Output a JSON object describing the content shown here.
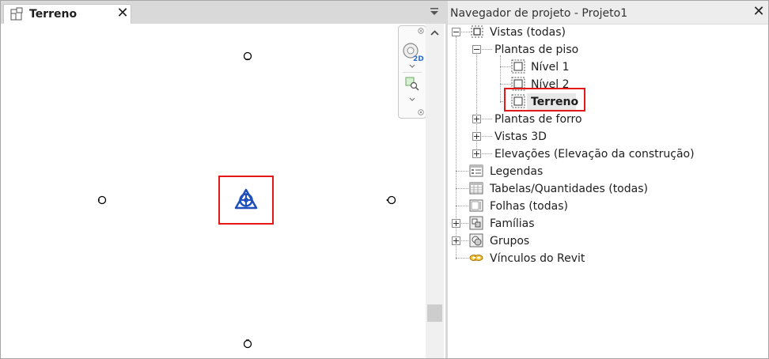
{
  "view_tab": {
    "label": "Terreno",
    "close_glyph": "✕",
    "icon": "floor-plan-icon"
  },
  "view_controls": {
    "badge_2d": "2D"
  },
  "browser": {
    "title": "Navegador de projeto - Projeto1",
    "close_glyph": "✕",
    "tree": {
      "views": "Vistas (todas)",
      "floor_plans": "Plantas de piso",
      "level1": "Nível 1",
      "level2": "Nível 2",
      "site": "Terreno",
      "ceiling_plans": "Plantas de forro",
      "views3d": "Vistas 3D",
      "elevations": "Elevações (Elevação da construção)",
      "legends": "Legendas",
      "schedules": "Tabelas/Quantidades (todas)",
      "sheets": "Folhas (todas)",
      "families": "Famílias",
      "groups": "Grupos",
      "revit_links": "Vínculos do Revit"
    }
  },
  "colors": {
    "highlight": "#e51818",
    "survey_point": "#1f4fb8",
    "selection_bg": "#e8e8e8"
  }
}
